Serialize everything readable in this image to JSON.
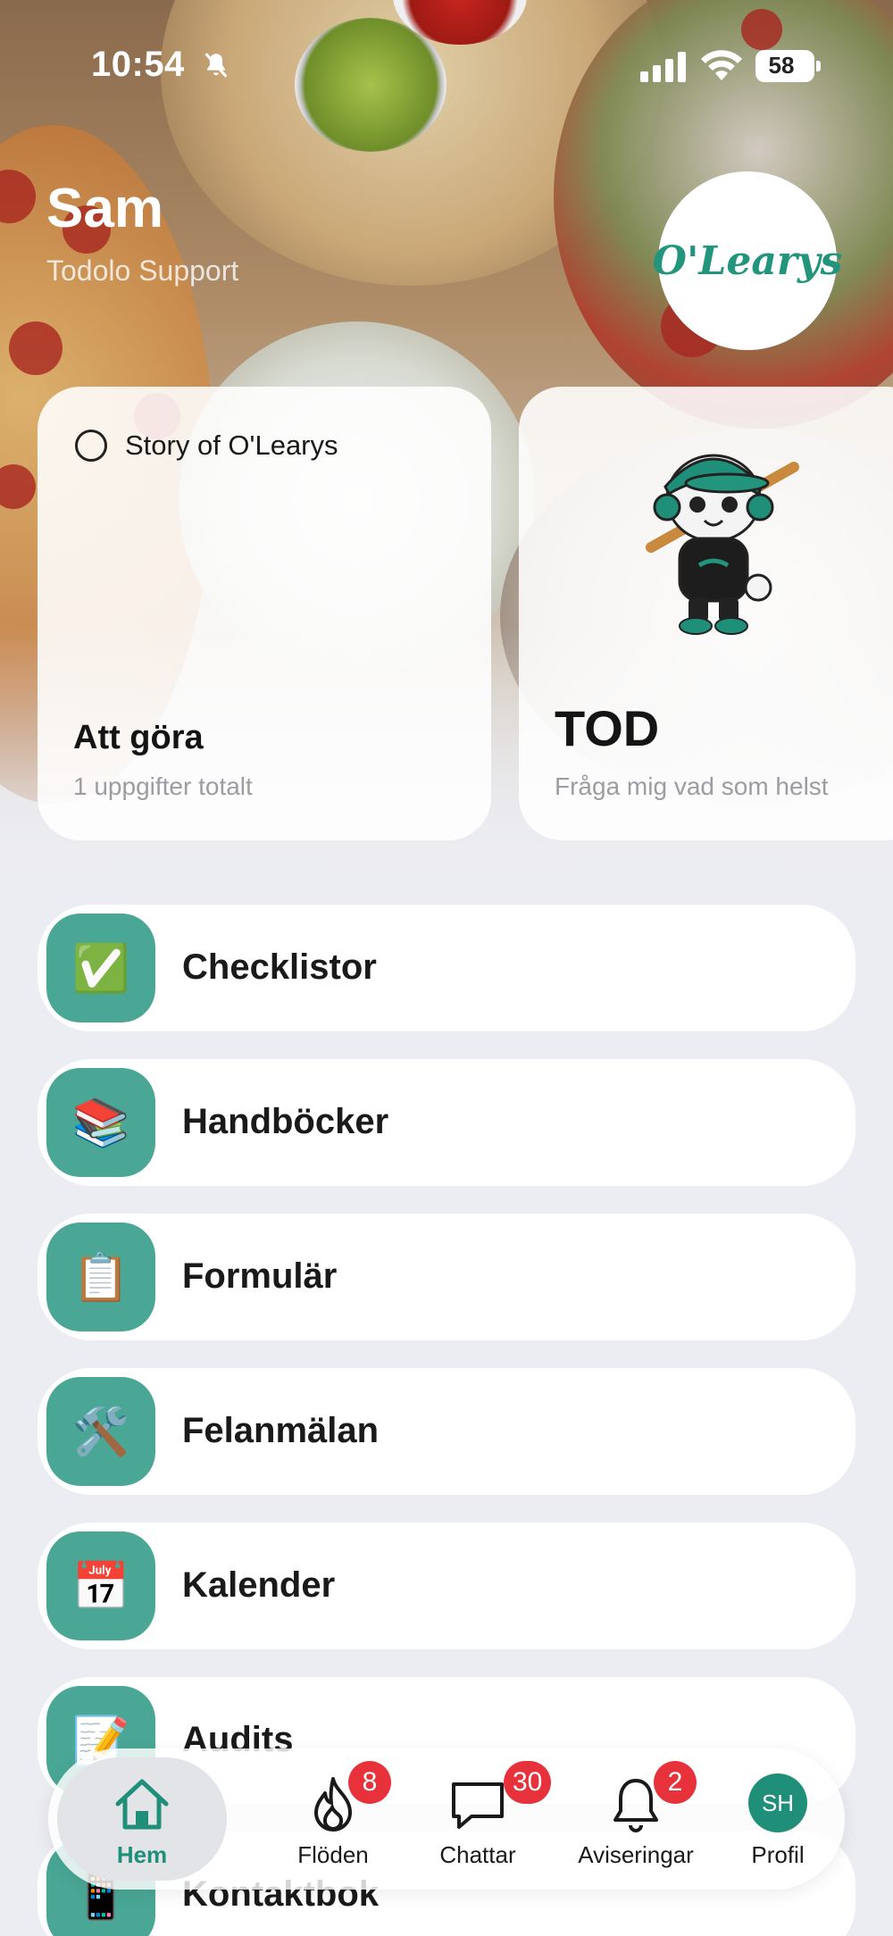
{
  "status_bar": {
    "time": "10:54",
    "battery": "58"
  },
  "header": {
    "user_name": "Sam",
    "user_role": "Todolo Support",
    "logo_text": "O'Learys"
  },
  "cards": {
    "todo": {
      "item": "Story of O'Learys",
      "title": "Att göra",
      "subtitle": "1 uppgifter totalt"
    },
    "tod": {
      "title": "TOD",
      "subtitle": "Fråga mig vad som helst"
    }
  },
  "menu": [
    {
      "label": "Checklistor",
      "icon": "✅",
      "icon_name": "check-icon"
    },
    {
      "label": "Handböcker",
      "icon": "📚",
      "icon_name": "books-icon"
    },
    {
      "label": "Formulär",
      "icon": "📋",
      "icon_name": "clipboard-icon"
    },
    {
      "label": "Felanmälan",
      "icon": "🛠️",
      "icon_name": "tools-icon"
    },
    {
      "label": "Kalender",
      "icon": "📅",
      "icon_name": "calendar-icon"
    },
    {
      "label": "Audits",
      "icon": "📝",
      "icon_name": "memo-icon"
    },
    {
      "label": "Kontaktbok",
      "icon": "📱",
      "icon_name": "phone-icon"
    }
  ],
  "tabbar": {
    "home": {
      "label": "Hem"
    },
    "feeds": {
      "label": "Flöden",
      "badge": "8"
    },
    "chats": {
      "label": "Chattar",
      "badge": "30"
    },
    "notifications": {
      "label": "Aviseringar",
      "badge": "2"
    },
    "profile": {
      "label": "Profil",
      "initials": "SH"
    }
  },
  "colors": {
    "accent": "#4aa795",
    "brand_green": "#1f8f7a",
    "badge_red": "#e8323b"
  }
}
